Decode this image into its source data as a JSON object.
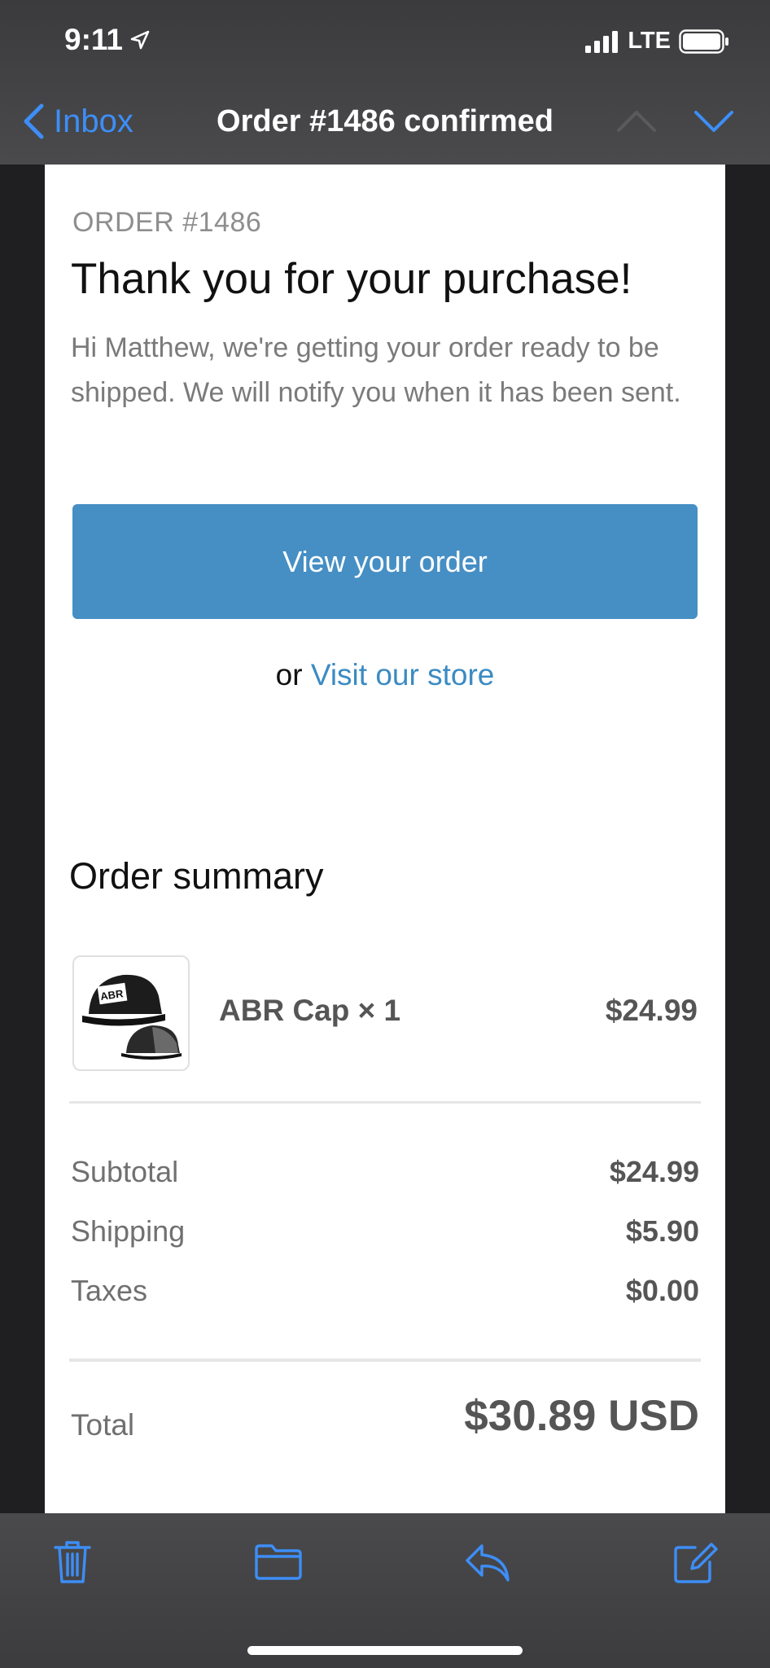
{
  "status_bar": {
    "time": "9:11",
    "network": "LTE",
    "icons": [
      "location-arrow-icon",
      "signal-icon",
      "battery-icon"
    ]
  },
  "nav": {
    "back_label": "Inbox",
    "title": "Order #1486 confirmed",
    "icons": [
      "chevron-left-icon",
      "chevron-up-icon",
      "chevron-down-icon"
    ]
  },
  "email": {
    "order_label": "ORDER #1486",
    "headline": "Thank you for your purchase!",
    "intro": "Hi Matthew, we're getting your order ready to be shipped. We will notify you when it has been sent.",
    "view_button": "View your order",
    "or_text": "or ",
    "visit_link": "Visit our store",
    "summary_title": "Order summary",
    "item": {
      "name": "ABR Cap × 1",
      "price": "$24.99",
      "thumb_text": "ABR"
    },
    "subtotal_label": "Subtotal",
    "subtotal_value": "$24.99",
    "shipping_label": "Shipping",
    "shipping_value": "$5.90",
    "taxes_label": "Taxes",
    "taxes_value": "$0.00",
    "total_label": "Total",
    "total_value": "$30.89 USD"
  },
  "toolbar": {
    "icons": [
      "trash-icon",
      "folder-icon",
      "reply-icon",
      "compose-icon"
    ]
  },
  "colors": {
    "accent": "#3d8ef7",
    "button": "#468fc4",
    "link": "#3b8bc2"
  }
}
